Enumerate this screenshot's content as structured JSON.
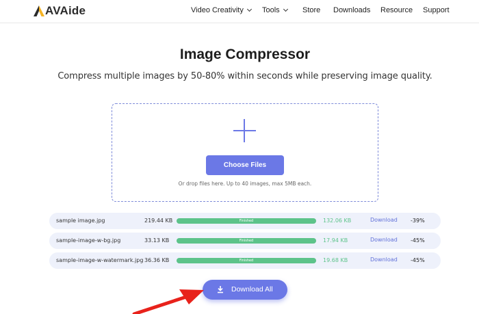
{
  "brand": {
    "name": "AVAide"
  },
  "nav": [
    {
      "label": "Video Creativity",
      "dropdown": true
    },
    {
      "label": "Tools",
      "dropdown": true
    },
    {
      "label": "Store",
      "dropdown": false
    },
    {
      "label": "Downloads",
      "dropdown": false
    },
    {
      "label": "Resource",
      "dropdown": false
    },
    {
      "label": "Support",
      "dropdown": false
    }
  ],
  "main": {
    "title": "Image Compressor",
    "subtitle": "Compress multiple images by 50-80% within seconds while preserving image quality.",
    "choose_label": "Choose Files",
    "drop_hint": "Or drop files here. Up to 40 images, max 5MB each."
  },
  "files": [
    {
      "name": "sample image.jpg",
      "original_size": "219.44 KB",
      "status": "Finished",
      "progress": 1.0,
      "compressed_size": "132.06 KB",
      "action": "Download",
      "reduction": "-39%"
    },
    {
      "name": "sample-image-w-bg.jpg",
      "original_size": "33.13 KB",
      "status": "Finished",
      "progress": 1.0,
      "compressed_size": "17.94 KB",
      "action": "Download",
      "reduction": "-45%"
    },
    {
      "name": "sample-image-w-watermark.jpg",
      "original_size": "36.36 KB",
      "status": "Finished",
      "progress": 1.0,
      "compressed_size": "19.68 KB",
      "action": "Download",
      "reduction": "-45%"
    }
  ],
  "download_all_label": "Download All",
  "colors": {
    "accent": "#6b78e6",
    "success": "#5dc38a",
    "row_bg": "#eef1fb",
    "link": "#5f6fd8",
    "arrow": "#e8221b"
  }
}
